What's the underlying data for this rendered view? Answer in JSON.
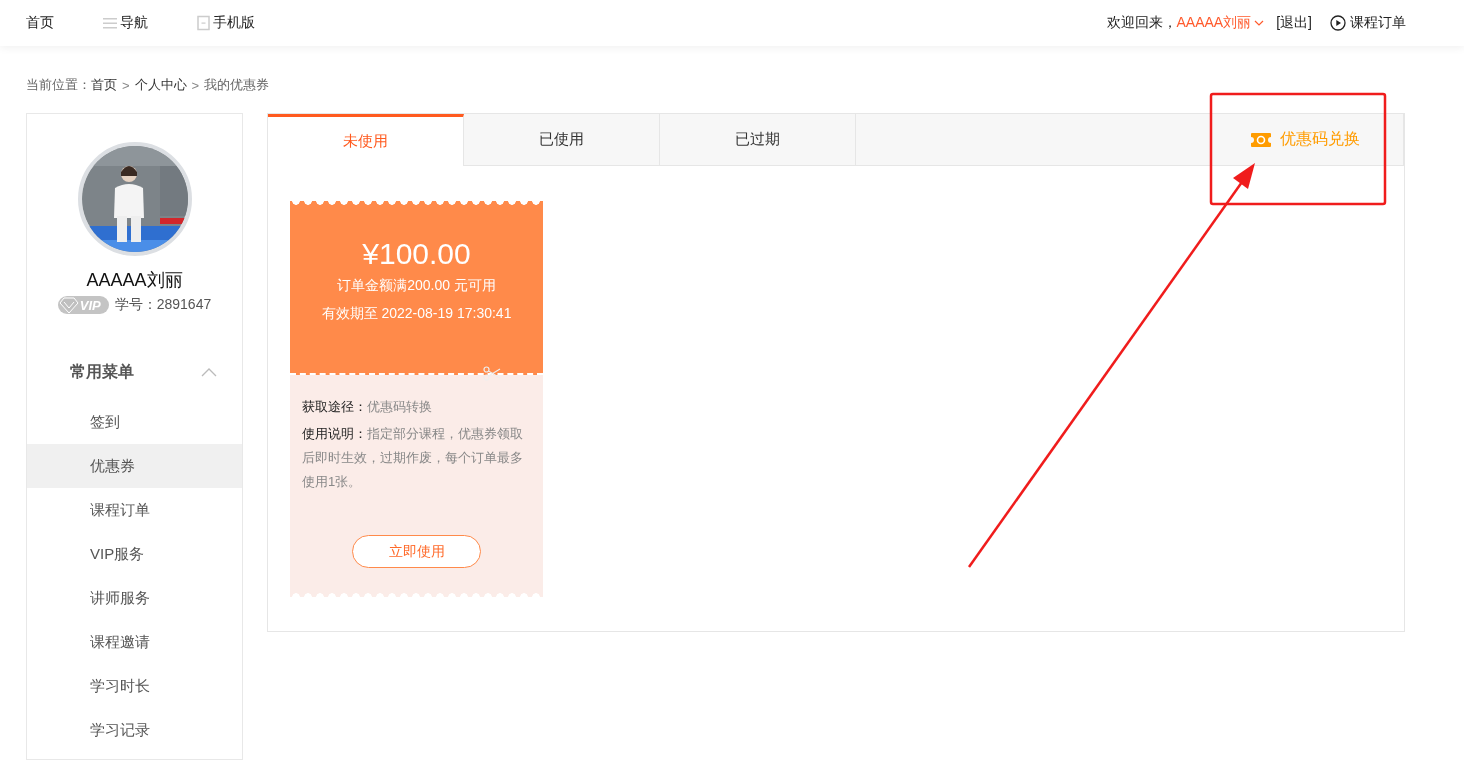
{
  "header": {
    "nav": [
      {
        "label": "首页",
        "kind": "plain"
      },
      {
        "label": "导航",
        "kind": "menu"
      },
      {
        "label": "手机版",
        "kind": "phone"
      }
    ],
    "greeting": "欢迎回来，",
    "username": "AAAAA刘丽",
    "logout": "[退出]",
    "orders_link": "课程订单"
  },
  "breadcrumb": {
    "prefix": "当前位置：",
    "separator": ">",
    "items": [
      "首页",
      "个人中心",
      "我的优惠券"
    ]
  },
  "profile": {
    "name": "AAAAA刘丽",
    "vip_badge": "VIP",
    "student_id": "学号：2891647"
  },
  "menu": {
    "title": "常用菜单",
    "expanded": true,
    "items": [
      {
        "label": "签到",
        "selected": false
      },
      {
        "label": "优惠券",
        "selected": true
      },
      {
        "label": "课程订单",
        "selected": false
      },
      {
        "label": "VIP服务",
        "selected": false
      },
      {
        "label": "讲师服务",
        "selected": false
      },
      {
        "label": "课程邀请",
        "selected": false
      },
      {
        "label": "学习时长",
        "selected": false
      },
      {
        "label": "学习记录",
        "selected": false
      }
    ]
  },
  "tabs": [
    {
      "label": "未使用",
      "selected": true
    },
    {
      "label": "已使用",
      "selected": false
    },
    {
      "label": "已过期",
      "selected": false
    }
  ],
  "redeem": {
    "label": "优惠码兑换"
  },
  "coupons": [
    {
      "amount": "¥100.00",
      "condition": "订单金额满200.00 元可用",
      "expiry": "有效期至 2022-08-19 17:30:41",
      "source_label": "获取途径：",
      "source": "优惠码转换",
      "usage_label": "使用说明：",
      "usage": "指定部分课程，优惠券领取后即时生效，过期作废，每个订单最多使用1张。",
      "button": "立即使用"
    }
  ],
  "annotation": {
    "box": true,
    "arrow": true
  }
}
